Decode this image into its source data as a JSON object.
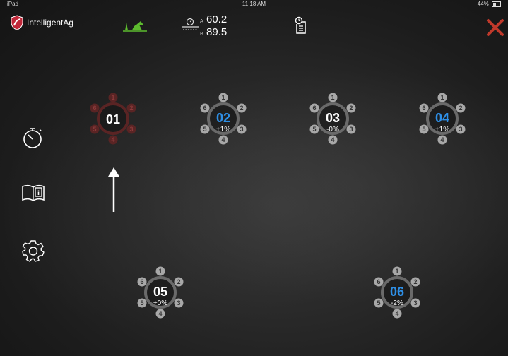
{
  "status_bar": {
    "left": "iPad",
    "time": "11:18 AM",
    "battery": "44%"
  },
  "brand": {
    "name": "IntelligentAg"
  },
  "readings": [
    {
      "label": "A",
      "value": "60.2"
    },
    {
      "label": "B",
      "value": "89.5"
    }
  ],
  "colors": {
    "accent_blue": "#2e8fe6",
    "alert_red": "#c0392b",
    "implement_green": "#5dbb2e"
  },
  "groups": [
    {
      "id": "01",
      "percent": "",
      "state": "alert",
      "nozzles": [
        "1",
        "2",
        "3",
        "4",
        "5",
        "6"
      ]
    },
    {
      "id": "02",
      "percent": "+1%",
      "state": "active",
      "nozzles": [
        "1",
        "2",
        "3",
        "4",
        "5",
        "6"
      ]
    },
    {
      "id": "03",
      "percent": "-0%",
      "state": "normal",
      "nozzles": [
        "1",
        "2",
        "3",
        "4",
        "5",
        "6"
      ]
    },
    {
      "id": "04",
      "percent": "+1%",
      "state": "active",
      "nozzles": [
        "1",
        "2",
        "3",
        "4",
        "5",
        "6"
      ]
    },
    {
      "id": "05",
      "percent": "+0%",
      "state": "normal",
      "nozzles": [
        "1",
        "2",
        "3",
        "4",
        "5",
        "6"
      ]
    },
    {
      "id": "06",
      "percent": "-2%",
      "state": "active",
      "nozzles": [
        "1",
        "2",
        "3",
        "4",
        "5",
        "6"
      ]
    }
  ],
  "icons": {
    "tractor": "tractor-implement-icon",
    "speed": "speed-sensor-icon",
    "report": "report-clipboard-icon",
    "close": "close-icon",
    "timer": "stopwatch-icon",
    "manual": "manual-book-icon",
    "settings": "gear-icon"
  }
}
